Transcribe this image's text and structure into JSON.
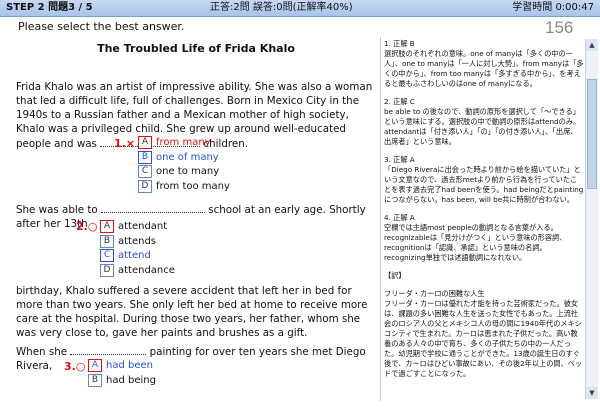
{
  "header": {
    "step_label": "STEP 2  問題3 / 5",
    "stats": "正答:2問  誤答:0問(正解率40%)",
    "timer": "学習時間  0:00:47"
  },
  "instruction": "Please select the best answer.",
  "question_number": "156",
  "passage": {
    "title": "The Troubled Life of Frida Khalo",
    "para1_a": "Frida Khalo was an artist of impressive ability. She was also a woman that led a difficult life, full of challenges. Born in Mexico City in the 1940s to a Russian father and a Mexican mother of high society, Khalo was a privileged child. She grew up around well-educated people and was ",
    "para1_b": " children.",
    "para2_a": "She was able to ",
    "para2_b": " school at an early age. Shortly after her 13th",
    "para3": "birthday, Khalo suffered a severe accident that left her in bed for more than two years. She only left her bed at home to receive more care at the hospital. During those two years, her father, whom she was very close to, gave her paints and brushes as a gift.",
    "para4_a": "When she ",
    "para4_b": " painting for over ten years she met Diego Rivera,"
  },
  "questions": [
    {
      "mark": "1.×",
      "options": [
        {
          "letter": "A",
          "text": "from many"
        },
        {
          "letter": "B",
          "text": "one of many"
        },
        {
          "letter": "C",
          "text": "one to many"
        },
        {
          "letter": "D",
          "text": "from too many"
        }
      ]
    },
    {
      "mark": "2.○",
      "options": [
        {
          "letter": "A",
          "text": "attendant"
        },
        {
          "letter": "B",
          "text": "attends"
        },
        {
          "letter": "C",
          "text": "attend"
        },
        {
          "letter": "D",
          "text": "attendance"
        }
      ]
    },
    {
      "mark": "3.○",
      "options": [
        {
          "letter": "A",
          "text": "had been"
        },
        {
          "letter": "B",
          "text": "had being"
        }
      ]
    }
  ],
  "explanation": {
    "e1": "1. 正解 B\n選択肢のそれぞれの意味。one of manyは「多くの中の一人」、one to manyは「一人に対し大勢」、from manyは「多くの中から」、from too manyは「多すぎる中から」、を考えると最もふさわしいのはone of manyになる。",
    "e2": "2. 正解 C\nbe able to の後なので、動詞の原形を選択して「〜できる」という意味にする。選択肢の中で動詞の原形はattendのみ。attendantは「付き添い人」「の」「の付き添い人」、「出席、出席者」という意味。",
    "e3": "3. 正解 A\n「Diego Riveraに出会った時より前から絵を描いていた」という文意なので、過去形metより前から行為を行っていたことを表す過去完了had beenを使う。had beingだとpaintingにつながらない。has been, will be共に時制が合わない。",
    "e4": "4. 正解 A\n空欄では主語most peopleの動詞となる言葉が入る。recognizableは「見分けがつく」という意味の形容詞、recognitionは「認識、承認」という意味の名詞。recognizing単独では述語動詞になれない。",
    "e5": "【訳】",
    "e6": "フリーダ・カーロの困難な人生\nフリーダ・カーロは優れた才能を持った芸術家だった。彼女は、課題の多い困難な人生を送った女性でもあった。上流社会のロシア人の父とメキシコ人の母の間に1940年代のメキシコシティで生まれた。カーロは恵まれた子供だった。高い教養のある人々の中で育ち、多くの子供たちの中の一人だった。幼児期で学校に通うことができた。13歳の誕生日のすぐ後で、カーロはひどい事故にあい、その後2年以上の間、ベッドで過ごすことになった。"
  },
  "colors": {
    "correct": "#e01010",
    "selected": "#2a4fd8"
  },
  "icons": {
    "scroll_up": "triangle-up",
    "scroll_down": "triangle-down"
  }
}
